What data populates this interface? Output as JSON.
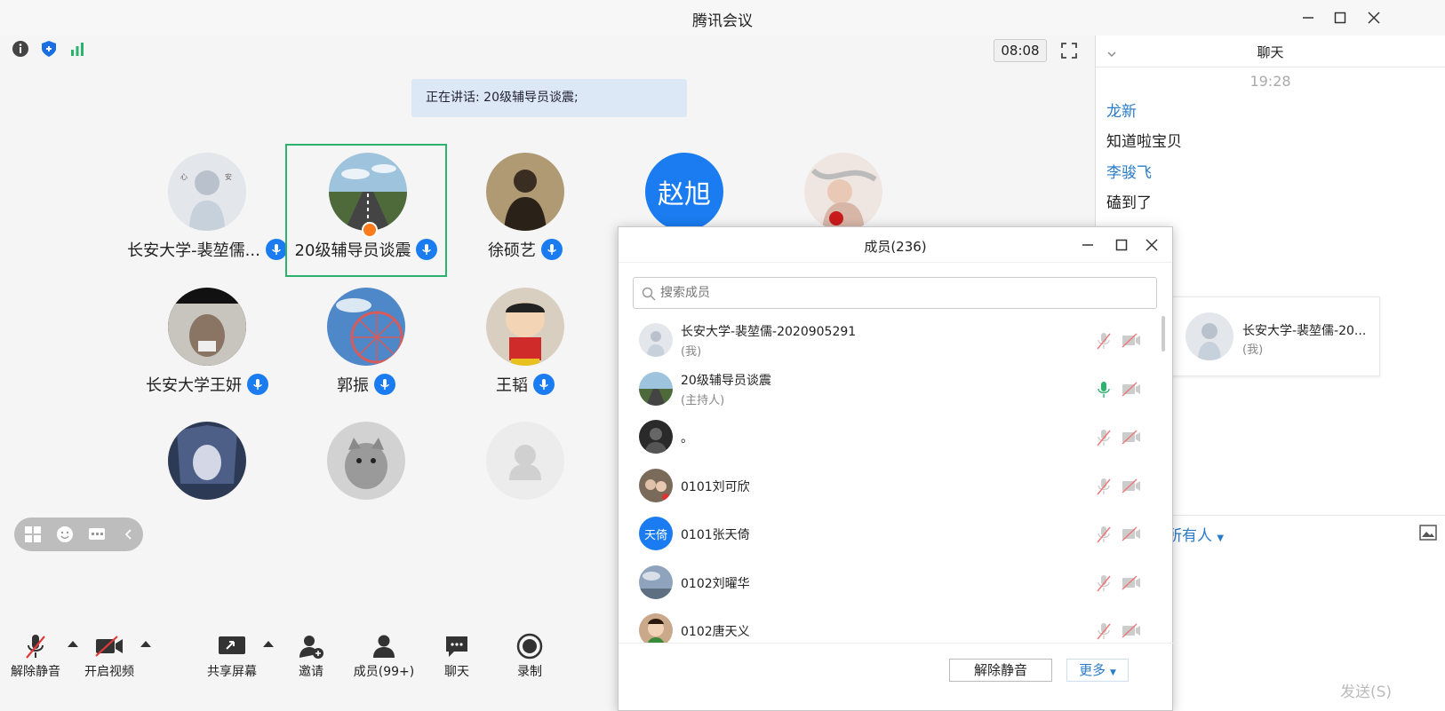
{
  "window": {
    "title": "腾讯会议"
  },
  "main": {
    "timer": "08:08",
    "speaking_text": "正在讲话: 20级辅导员谈震;",
    "participants": [
      {
        "name": "长安大学-裴堃儒...",
        "avatar": "sketch-boy",
        "color": "#d8dde3"
      },
      {
        "name": "20级辅导员谈震",
        "avatar": "runway",
        "color": "#5b7c8f"
      },
      {
        "name": "徐硕艺",
        "avatar": "warrior",
        "color": "#6a5a45"
      },
      {
        "name": "赵旭",
        "avatar": "text-avatar",
        "color": "#1a7cf0"
      },
      {
        "name": "",
        "avatar": "girl-wind",
        "color": "#e8d0c6"
      },
      {
        "name": "长安大学王妍",
        "avatar": "child-photo",
        "color": "#6d6157"
      },
      {
        "name": "郭振",
        "avatar": "ferris-wheel",
        "color": "#5a8fc9"
      },
      {
        "name": "王韬",
        "avatar": "crayon-shin",
        "color": "#d8cfc0"
      },
      {
        "name": "",
        "avatar": "anime-girl",
        "color": "#3d4d6c"
      },
      {
        "name": "",
        "avatar": "cat",
        "color": "#bbb"
      },
      {
        "name": "",
        "avatar": "default-user",
        "color": "#ececec"
      }
    ]
  },
  "toolbar": {
    "unmute": "解除静音",
    "start_video": "开启视频",
    "share_screen": "共享屏幕",
    "invite": "邀请",
    "members": "成员(99+)",
    "chat": "聊天",
    "record": "录制"
  },
  "chat": {
    "title": "聊天",
    "time": "19:28",
    "messages": [
      {
        "sender": "龙新",
        "text": "知道啦宝贝"
      },
      {
        "sender": "李骏飞",
        "text": "磕到了"
      }
    ],
    "self_card": {
      "name": "长安大学-裴堃儒-20...",
      "sub": "(我)"
    },
    "recipient": "所有人",
    "send": "发送(S)"
  },
  "members_dialog": {
    "title": "成员(236)",
    "search_placeholder": "搜索成员",
    "members": [
      {
        "name": "长安大学-裴堃儒-2020905291",
        "role": "(我)",
        "avatar": "sketch-boy",
        "mic_on": false
      },
      {
        "name": "20级辅导员谈震",
        "role": "(主持人)",
        "avatar": "runway",
        "mic_on": true
      },
      {
        "name": "。",
        "role": "",
        "avatar": "dark-portrait",
        "mic_on": false
      },
      {
        "name": "0101刘可欣",
        "role": "",
        "avatar": "girls-photo",
        "mic_on": false
      },
      {
        "name": "0101张天倚",
        "role": "",
        "avatar": "text-avatar",
        "mic_on": false
      },
      {
        "name": "0102刘曜华",
        "role": "",
        "avatar": "sky",
        "mic_on": false
      },
      {
        "name": "0102唐天义",
        "role": "",
        "avatar": "cartoon-boy",
        "mic_on": false
      }
    ],
    "text_avatar_label": "天倚",
    "unmute_all": "解除静音",
    "more": "更多"
  }
}
